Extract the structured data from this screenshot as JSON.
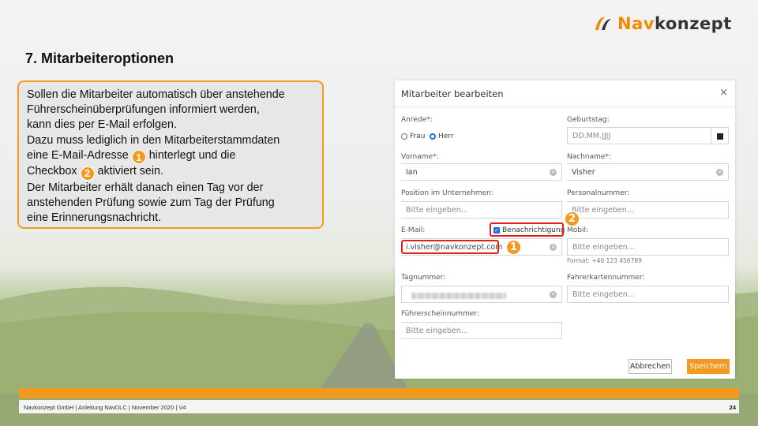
{
  "logo": {
    "part1": "Nav",
    "part2": "konzept"
  },
  "slide_title": "7. Mitarbeiteroptionen",
  "info": {
    "l1": "Sollen die Mitarbeiter automatisch über anstehende",
    "l2": "Führerscheinüberprüfungen informiert werden,",
    "l3": "kann dies per E-Mail erfolgen.",
    "l4": "Dazu muss lediglich in den Mitarbeiterstammdaten",
    "l5a": "eine E-Mail-Adresse",
    "l5b": "hinterlegt und die",
    "l6a": "Checkbox",
    "l6b": "aktiviert sein.",
    "l7": "Der Mitarbeiter erhält danach einen Tag vor der",
    "l8": "anstehenden Prüfung sowie zum Tag der Prüfung",
    "l9": "eine Erinnerungsnachricht.",
    "badge1": "1",
    "badge2": "2"
  },
  "dialog": {
    "title": "Mitarbeiter bearbeiten",
    "close": "×",
    "anrede_label": "Anrede*:",
    "radio_frau": "Frau",
    "radio_herr": "Herr",
    "geburtstag_label": "Geburtstag:",
    "geburtstag_value": "DD.MM.JJJJ",
    "vorname_label": "Vorname*:",
    "vorname_value": "Ian",
    "nachname_label": "Nachname*:",
    "nachname_value": "Visher",
    "position_label": "Position im Unternehmen:",
    "position_placeholder": "Bitte eingeben...",
    "personalnummer_label": "Personalnummer:",
    "personalnummer_placeholder": "Bitte eingeben...",
    "email_label": "E-Mail:",
    "email_value": "i.visher@navkonzept.com",
    "benachrichtigung_label": "Benachrichtigung",
    "mobil_label": "Mobil:",
    "mobil_placeholder": "Bitte eingeben...",
    "mobil_hint": "Format: +40 123 456789",
    "tagnummer_label": "Tagnummer:",
    "fahrerkarte_label": "Fahrerkartennummer:",
    "fahrerkarte_placeholder": "Bitte eingeben...",
    "fuehrerschein_label": "Führerscheinnummer:",
    "fuehrerschein_placeholder": "Bitte eingeben...",
    "cancel": "Abbrechen",
    "save": "Speichern",
    "callout1": "1",
    "callout2": "2"
  },
  "footer": {
    "text": "Navkonzept GmbH  |  Anleitung NavDLC  |  November 2020  |  V4",
    "page": "24"
  },
  "colors": {
    "accent": "#f39a1e",
    "highlight": "#e21f1f",
    "checkbox": "#1e6ee0"
  }
}
